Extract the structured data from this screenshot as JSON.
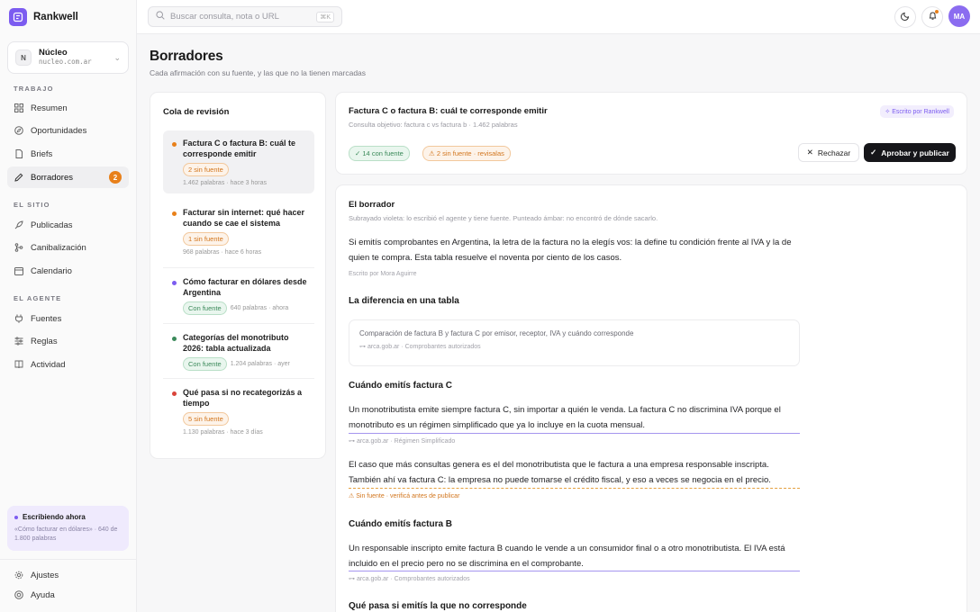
{
  "app": {
    "name": "Rankwell",
    "accent": "#7c5cf0"
  },
  "workspace": {
    "name": "Núcleo",
    "initial": "N",
    "domain": "nucleo.com.ar"
  },
  "nav": {
    "section_work": "TRABAJO",
    "section_site": "EL SITIO",
    "section_agent": "EL AGENTE",
    "items": {
      "resumen": "Resumen",
      "oportunidades": "Oportunidades",
      "briefs": "Briefs",
      "borradores": "Borradores",
      "borradores_badge": "2",
      "publicadas": "Publicadas",
      "canibalizacion": "Canibalización",
      "calendario": "Calendario",
      "fuentes": "Fuentes",
      "reglas": "Reglas",
      "actividad": "Actividad",
      "ajustes": "Ajustes",
      "ayuda": "Ayuda"
    }
  },
  "writing_now": {
    "title": "Escribiendo ahora",
    "text": "«Cómo facturar en dólares» · 640 de 1.800 palabras"
  },
  "topbar": {
    "search_placeholder": "Buscar consulta, nota o URL",
    "shortcut": "⌘K",
    "user_initials": "MA"
  },
  "page": {
    "title": "Borradores",
    "subtitle": "Cada afirmación con su fuente, y las que no la tienen marcadas"
  },
  "queue": {
    "title": "Cola de revisión",
    "items": [
      {
        "title": "Factura C o factura B: cuál te corresponde emitir",
        "pill": "2 sin fuente",
        "meta": "1.462 palabras · hace 3 horas",
        "dot": "#e8801a",
        "pill_type": "orange"
      },
      {
        "title": "Facturar sin internet: qué hacer cuando se cae el sistema",
        "pill": "1 sin fuente",
        "meta": "968 palabras · hace 6 horas",
        "dot": "#e8801a",
        "pill_type": "orange"
      },
      {
        "title": "Cómo facturar en dólares desde Argentina",
        "pill": "Con fuente",
        "meta": "640 palabras · ahora",
        "dot": "#7c5cf0",
        "pill_type": "green"
      },
      {
        "title": "Categorías del monotributo 2026: tabla actualizada",
        "pill": "Con fuente",
        "meta": "1.204 palabras · ayer",
        "dot": "#3b8a5a",
        "pill_type": "green"
      },
      {
        "title": "Qué pasa si no recategorizás a tiempo",
        "pill": "5 sin fuente",
        "meta": "1.130 palabras · hace 3 días",
        "dot": "#d9443a",
        "pill_type": "orange"
      }
    ]
  },
  "header": {
    "title": "Factura C o factura B: cuál te corresponde emitir",
    "subtitle": "Consulta objetivo: factura c vs factura b · 1.462 palabras",
    "tag": "Escrito por Rankwell",
    "badge_sourced": "14 con fuente",
    "badge_unsourced": "2 sin fuente · revisalas",
    "reject_label": "Rechazar",
    "approve_label": "Aprobar y publicar"
  },
  "draft": {
    "label": "El borrador",
    "hint": "Subrayado violeta: lo escribió el agente y tiene fuente. Punteado ámbar: no encontró de dónde sacarlo.",
    "intro": "Si emitís comprobantes en Argentina, la letra de la factura no la elegís vos: la define tu condición frente al IVA y la de quien te compra. Esta tabla resuelve el noventa por ciento de los casos.",
    "byline": "Escrito por Mora Aguirre",
    "h_table": "La diferencia en una tabla",
    "table_title": "Comparación de factura B y factura C por emisor, receptor, IVA y cuándo corresponde",
    "table_source": "arca.gob.ar · Comprobantes autorizados",
    "h_c": "Cuándo emitís factura C",
    "p_c1": "Un monotributista emite siempre factura C, sin importar a quién le venda. La factura C no discrimina IVA porque el monotributo es un régimen simplificado que ya lo incluye en la cuota mensual.",
    "src_c1": "arca.gob.ar · Régimen Simplificado",
    "p_c2": "El caso que más consultas genera es el del monotributista que le factura a una empresa responsable inscripta. También ahí va factura C: la empresa no puede tomarse el crédito fiscal, y eso a veces se negocia en el precio.",
    "warn_c2": "Sin fuente · verificá antes de publicar",
    "h_b": "Cuándo emitís factura B",
    "p_b1": "Un responsable inscripto emite factura B cuando le vende a un consumidor final o a otro monotributista. El IVA está incluido en el precio pero no se discrimina en el comprobante.",
    "src_b1": "arca.gob.ar · Comprobantes autorizados",
    "h_wrong": "Qué pasa si emitís la que no corresponde"
  }
}
